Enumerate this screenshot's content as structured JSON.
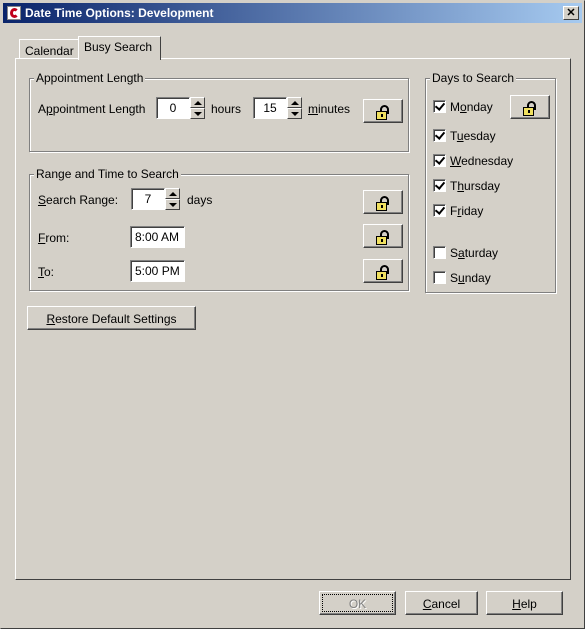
{
  "window": {
    "title": "Date Time Options:  Development"
  },
  "tabs": [
    {
      "label": "Calendar"
    },
    {
      "label": "Busy Search",
      "selected": true
    }
  ],
  "appointment_length": {
    "group_label": "Appointment Length",
    "label_pre": "A",
    "label_key": "p",
    "label_post": "pointment Length",
    "hours_value": "0",
    "hours_label": "hours",
    "minutes_value": "15",
    "minutes_key": "m",
    "minutes_post": "inutes"
  },
  "range_time": {
    "group_label": "Range and Time to Search",
    "range_key": "S",
    "range_post": "earch Range:",
    "range_value": "7",
    "range_unit": "days",
    "from_key": "F",
    "from_post": "rom:",
    "from_value": "8:00 AM",
    "to_key": "T",
    "to_post": "o:",
    "to_value": "5:00 PM"
  },
  "restore_button": {
    "key": "R",
    "post": "estore Default Settings"
  },
  "days": {
    "group_label": "Days to Search",
    "items": [
      {
        "pre": "M",
        "key": "o",
        "post": "nday",
        "checked": true
      },
      {
        "pre": "T",
        "key": "u",
        "post": "esday",
        "checked": true
      },
      {
        "pre": "",
        "key": "W",
        "post": "ednesday",
        "checked": true
      },
      {
        "pre": "T",
        "key": "h",
        "post": "ursday",
        "checked": true
      },
      {
        "pre": "F",
        "key": "r",
        "post": "iday",
        "checked": true
      },
      {
        "pre": "S",
        "key": "a",
        "post": "turday",
        "checked": false
      },
      {
        "pre": "S",
        "key": "u",
        "post": "nday",
        "checked": false
      }
    ]
  },
  "footer": {
    "ok_label": "OK",
    "ok_disabled": true,
    "cancel_key": "C",
    "cancel_post": "ancel",
    "help_key": "H",
    "help_post": "elp"
  },
  "icons": {
    "lock": "unlocked-padlock-icon",
    "spin_up": "spin-up-arrow-icon",
    "spin_down": "spin-down-arrow-icon",
    "app": "app-logo-icon",
    "close": "close-icon"
  },
  "colors": {
    "titlebar_start": "#0a246a",
    "titlebar_end": "#a6caf0",
    "face": "#d4d0c8",
    "lock_yellow": "#f0e060"
  }
}
